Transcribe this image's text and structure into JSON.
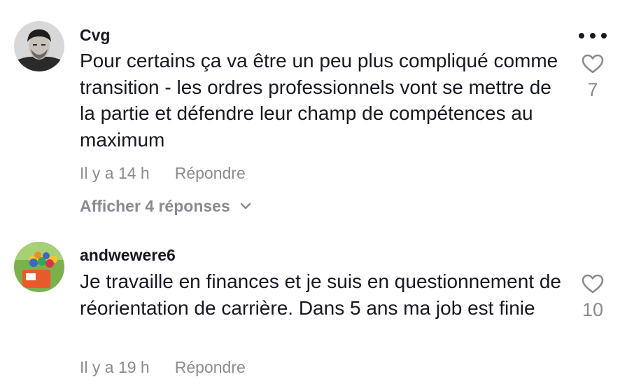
{
  "comments": [
    {
      "username": "Cvg",
      "text": "Pour certains ça va être un peu plus compliqué comme transition - les ordres professionnels vont se mettre de la partie et défendre leur champ de compétences au maximum",
      "time": "Il y a 14 h",
      "reply_label": "Répondre",
      "view_replies": "Afficher 4 réponses",
      "likes": "7",
      "avatar_icon": "user-photo-avatar"
    },
    {
      "username": "andwewere6",
      "text": "Je travaille en finances et je suis en questionnement de réorientation de carrière. Dans 5 ans ma job est finie",
      "time": "Il y a 19 h",
      "reply_label": "Répondre",
      "likes": "10",
      "avatar_icon": "toy-photo-avatar"
    }
  ],
  "icons": {
    "more": "more-options-icon",
    "like": "heart-outline-icon",
    "expand": "chevron-down-icon"
  },
  "colors": {
    "primary_text": "#161823",
    "secondary_text": "#8a8b91",
    "background": "#ffffff"
  }
}
